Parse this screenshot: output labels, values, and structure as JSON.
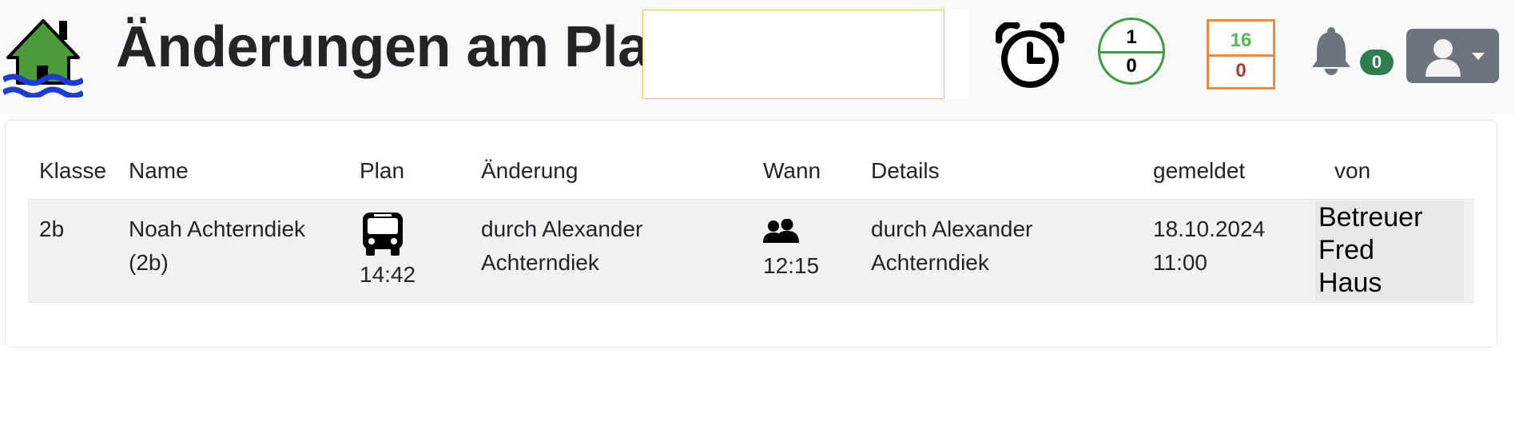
{
  "header": {
    "title": "Änderungen am Plan",
    "logo_icon": "house-flood-icon",
    "alarm_icon": "alarm-clock-icon",
    "circle_counter": {
      "top": "1",
      "bottom": "0",
      "color": "#3f9a45"
    },
    "box_counter": {
      "top": "16",
      "bottom": "0",
      "border_color": "#f0893c",
      "top_color": "#5bb55a",
      "bottom_color": "#b03a3a"
    },
    "notifications": {
      "icon": "bell-icon",
      "count": "0"
    },
    "user_menu": {
      "icon": "user-avatar-icon"
    }
  },
  "table": {
    "columns": [
      "Klasse",
      "Name",
      "Plan",
      "Änderung",
      "Wann",
      "Details",
      "gemeldet",
      "von"
    ],
    "rows": [
      {
        "klasse": "2b",
        "name_line1": "Noah Achterndiek",
        "name_line2": "(2b)",
        "plan_icon": "bus-icon",
        "plan_time": "14:42",
        "aenderung_line1": "durch Alexander",
        "aenderung_line2": "Achterndiek",
        "wann_icon": "people-icon",
        "wann_time": "12:15",
        "details_line1": "durch Alexander",
        "details_line2": "Achterndiek",
        "gemeldet_date": "18.10.2024",
        "gemeldet_time": "11:00",
        "von_line1": "Betreuer",
        "von_line2": "Fred",
        "von_line3": "Haus"
      }
    ]
  }
}
